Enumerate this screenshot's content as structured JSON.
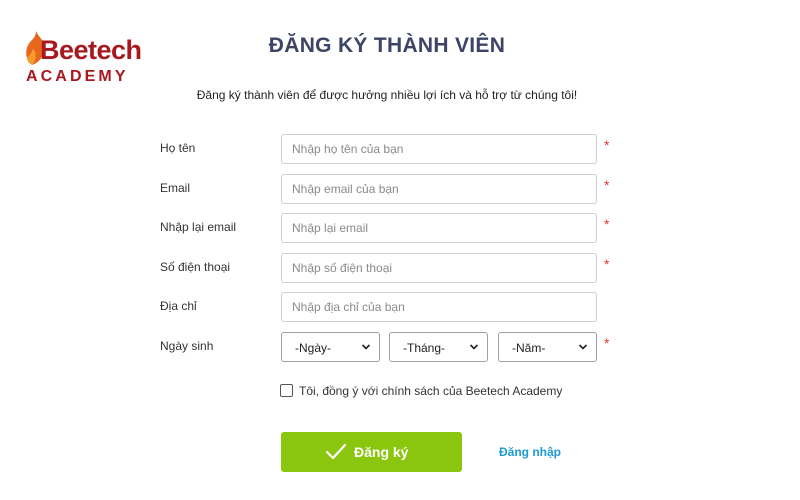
{
  "brand": {
    "wordmark": "Beetech",
    "sub": "ACADEMY"
  },
  "header": {
    "title": "ĐĂNG KÝ THÀNH VIÊN",
    "subtitle": "Đăng ký thành viên để được hưởng nhiều lợi ích và hỗ trợ từ chúng tôi!"
  },
  "form": {
    "fields": [
      {
        "label": "Họ tên",
        "placeholder": "Nhập họ tên của bạn",
        "value": "",
        "required": "*"
      },
      {
        "label": "Email",
        "placeholder": "Nhập email của bạn",
        "value": "",
        "required": "*"
      },
      {
        "label": "Nhập lại email",
        "placeholder": "Nhập lại email",
        "value": "",
        "required": "*"
      },
      {
        "label": "Số điện thoại",
        "placeholder": "Nhập số điện thoại",
        "value": "",
        "required": "*"
      },
      {
        "label": "Địa chỉ",
        "placeholder": "Nhập địa chỉ của bạn",
        "value": ""
      }
    ],
    "birthdate": {
      "label": "Ngày sinh",
      "day": "-Ngày-",
      "month": "-Tháng-",
      "year": "-Năm-",
      "required": "*"
    },
    "agree_label": "Tôi, đồng ý với chính sách của Beetech Academy",
    "agree_checked": false,
    "submit_label": "Đăng ký",
    "login_label": "Đăng nhập"
  },
  "colors": {
    "brand_red": "#a8191f",
    "title": "#3d4466",
    "required": "#e03b2e",
    "submit_bg": "#8bc60f",
    "link": "#1e9ad6"
  },
  "icons": {
    "logo": "flame-icon",
    "select_arrow": "chevron-down-icon",
    "submit": "check-icon"
  }
}
